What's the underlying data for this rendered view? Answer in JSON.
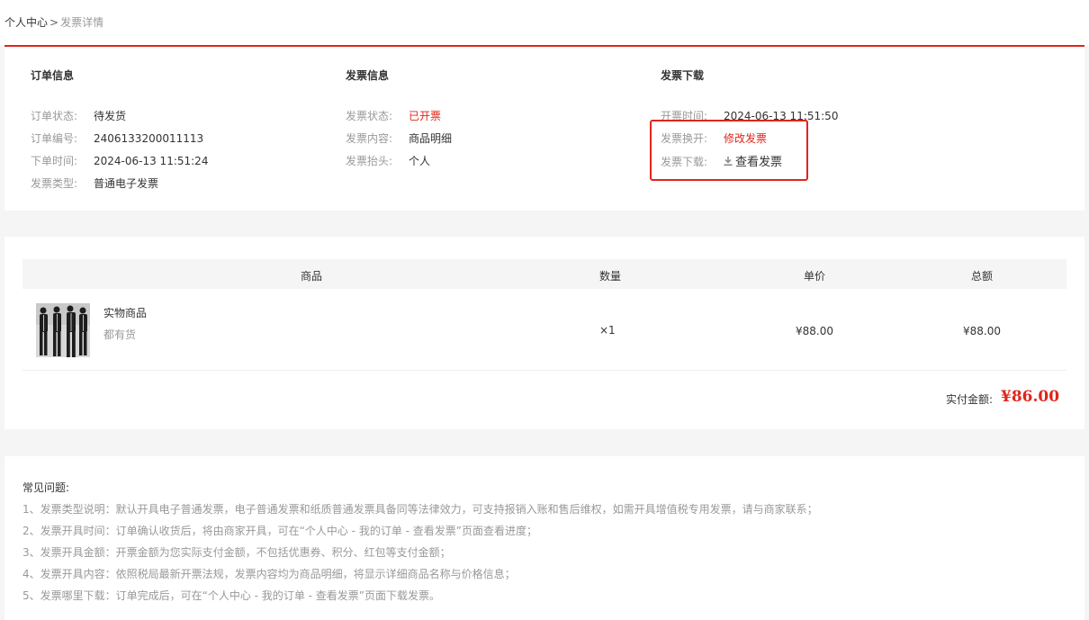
{
  "breadcrumb": {
    "home": "个人中心",
    "separator": ">",
    "current": "发票详情"
  },
  "order_info": {
    "title": "订单信息",
    "rows": [
      {
        "label": "订单状态:",
        "value": "待发货"
      },
      {
        "label": "订单编号:",
        "value": "2406133200011113"
      },
      {
        "label": "下单时间:",
        "value": "2024-06-13 11:51:24"
      },
      {
        "label": "发票类型:",
        "value": "普通电子发票"
      }
    ]
  },
  "invoice_info": {
    "title": "发票信息",
    "rows": [
      {
        "label": "发票状态:",
        "value": "已开票"
      },
      {
        "label": "发票内容:",
        "value": "商品明细"
      },
      {
        "label": "发票抬头:",
        "value": "个人"
      }
    ]
  },
  "invoice_download": {
    "title": "发票下载",
    "issue_time_label": "开票时间:",
    "issue_time_value": "2024-06-13 11:51:50",
    "reissue_label": "发票换开:",
    "reissue_link": "修改发票",
    "download_label": "发票下载:",
    "download_link": "查看发票",
    "download_icon": "download-icon"
  },
  "goods": {
    "headers": {
      "product": "商品",
      "quantity": "数量",
      "unit_price": "单价",
      "total": "总额"
    },
    "items": [
      {
        "name": "实物商品",
        "stock": "都有货",
        "quantity": "×1",
        "unit_price": "¥88.00",
        "total": "¥88.00"
      }
    ],
    "paid_label": "实付金额:",
    "paid_value": "¥86.00"
  },
  "faq": {
    "title": "常见问题:",
    "items": [
      "1、发票类型说明：默认开具电子普通发票，电子普通发票和纸质普通发票具备同等法律效力，可支持报销入账和售后维权，如需开具增值税专用发票，请与商家联系；",
      "2、发票开具时间：订单确认收货后，将由商家开具，可在“个人中心 - 我的订单 - 查看发票”页面查看进度；",
      "3、发票开具金额：开票金额为您实际支付金额，不包括优惠券、积分、红包等支付金额；",
      "4、发票开具内容：依照税局最新开票法规，发票内容均为商品明细，将显示详细商品名称与价格信息；",
      "5、发票哪里下载：订单完成后，可在“个人中心 - 我的订单 - 查看发票”页面下载发票。"
    ]
  },
  "colors": {
    "accent": "#e1251b",
    "muted": "#999999",
    "text": "#333333",
    "background": "#f5f5f5"
  }
}
